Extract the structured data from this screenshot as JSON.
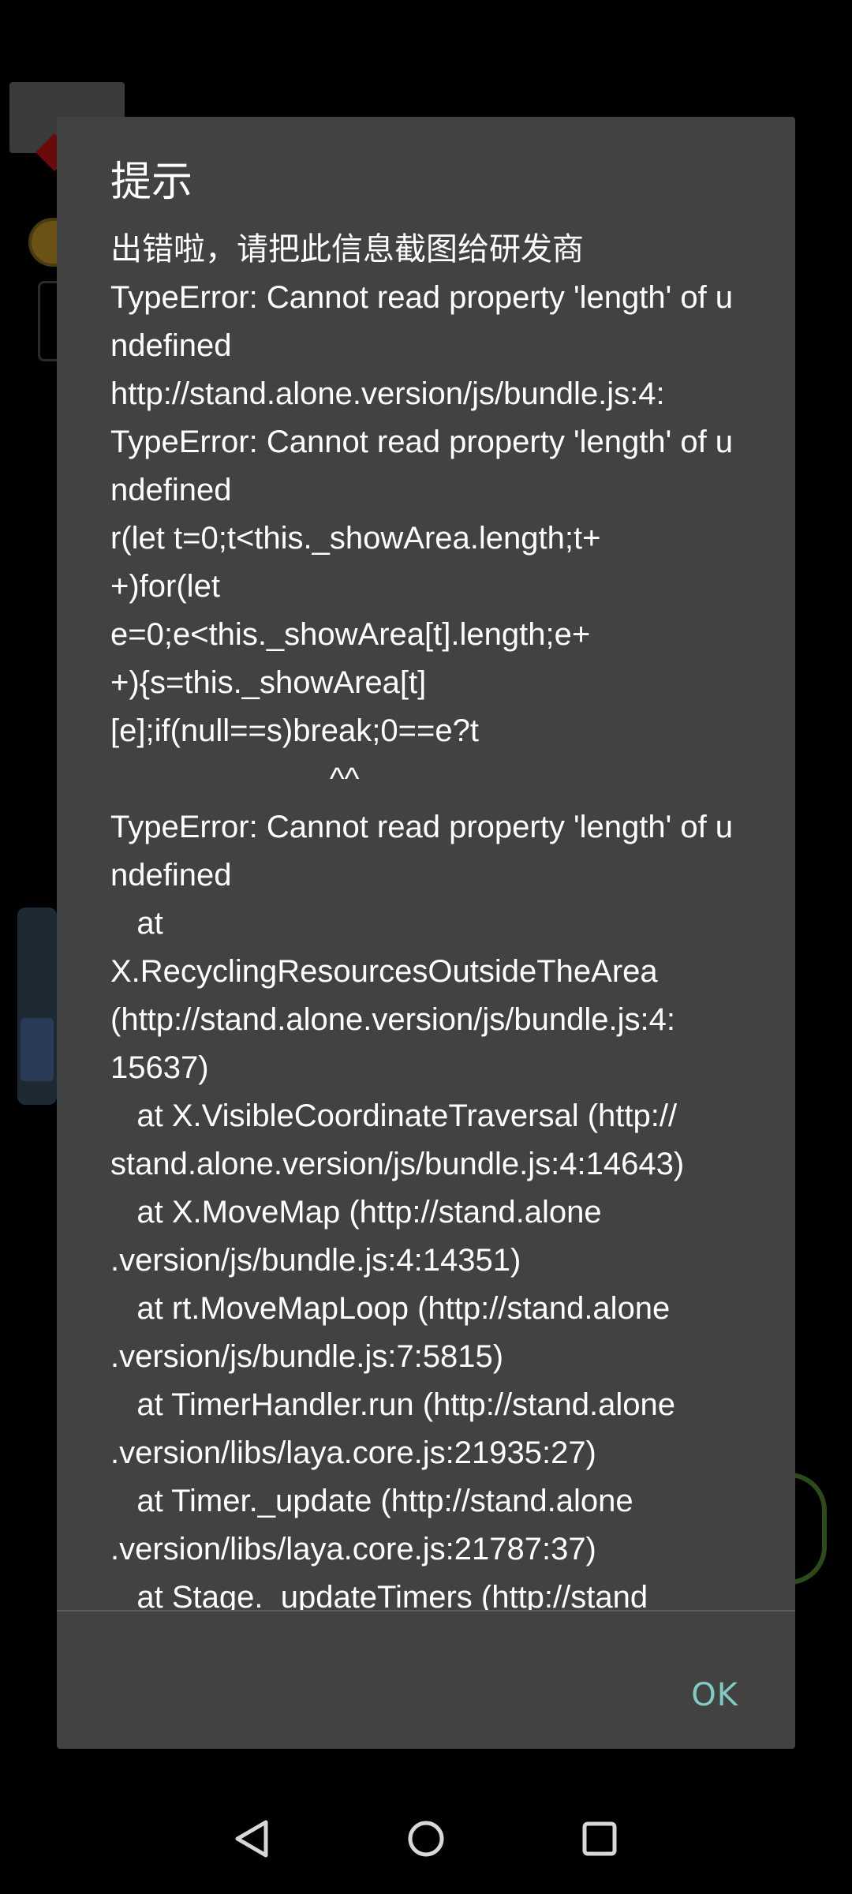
{
  "dialog": {
    "title": "提示",
    "message": "出错啦，请把此信息截图给研发商\nTypeError: Cannot read property 'length' of undefined\nhttp://stand.alone.version/js/bundle.js:4:\nTypeError: Cannot read property 'length' of undefined\nr(let t=0;t<this._showArea.length;t+\n+)for(let\ne=0;e<this._showArea[t].length;e+\n+){s=this._showArea[t]\n[e];if(null==s)break;0==e?t\n                         ^^\nTypeError: Cannot read property 'length' of undefined\n   at\nX.RecyclingResourcesOutsideTheArea\n(http://stand.alone.version/js/bundle.js:4:\n15637)\n   at X.VisibleCoordinateTraversal (http://\nstand.alone.version/js/bundle.js:4:14643)\n   at X.MoveMap (http://stand.alone\n.version/js/bundle.js:4:14351)\n   at rt.MoveMapLoop (http://stand.alone\n.version/js/bundle.js:7:5815)\n   at TimerHandler.run (http://stand.alone\n.version/libs/laya.core.js:21935:27)\n   at Timer._update (http://stand.alone\n.version/libs/laya.core.js:21787:37)\n   at Stage._updateTimers (http://stand",
    "ok_label": "OK"
  },
  "colors": {
    "dialog_bg": "#424242",
    "accent": "#80cbc4",
    "backdrop": "#000000"
  },
  "navbar": {
    "icons": [
      "back-icon",
      "home-icon",
      "recents-icon"
    ]
  }
}
